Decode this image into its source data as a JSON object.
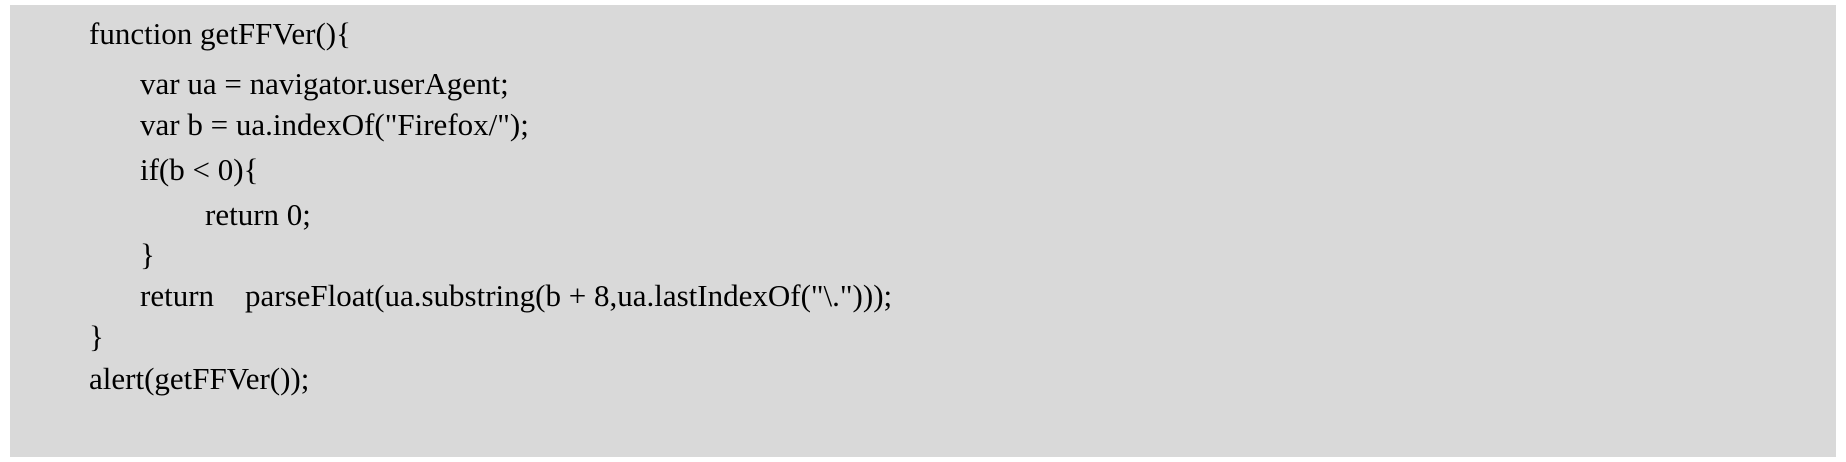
{
  "code": {
    "lines": [
      {
        "indent": 0,
        "text": "function getFFVer(){"
      },
      {
        "indent": 1,
        "text": "var ua = navigator.userAgent;"
      },
      {
        "indent": 1,
        "text": "var b = ua.indexOf(\"Firefox/\");"
      },
      {
        "indent": 1,
        "text": "if(b < 0){"
      },
      {
        "indent": 2,
        "text": "return 0;"
      },
      {
        "indent": 1,
        "text": "}"
      },
      {
        "indent": 1,
        "text": "return    parseFloat(ua.substring(b + 8,ua.lastIndexOf(\"\\.\")));"
      },
      {
        "indent": 0,
        "text": "}"
      },
      {
        "indent": 0,
        "text": "alert(getFFVer());"
      }
    ]
  },
  "colors": {
    "background": "#d9d9d9",
    "text": "#000000"
  }
}
